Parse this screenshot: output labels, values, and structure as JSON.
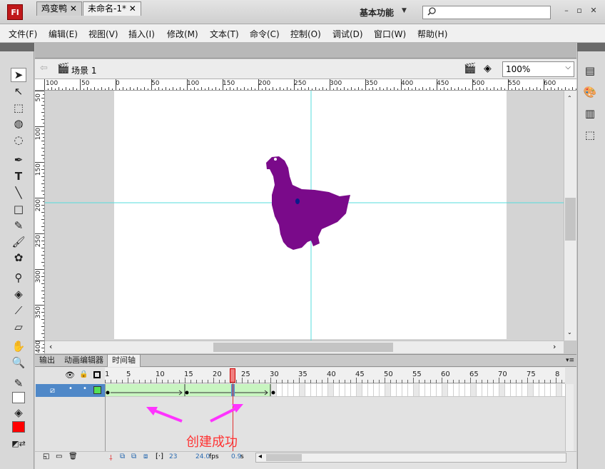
{
  "titlebar": {
    "logo": "Fl",
    "workspace": "基本功能",
    "search_placeholder": ""
  },
  "menu": [
    "文件(F)",
    "编辑(E)",
    "视图(V)",
    "插入(I)",
    "修改(M)",
    "文本(T)",
    "命令(C)",
    "控制(O)",
    "调试(D)",
    "窗口(W)",
    "帮助(H)"
  ],
  "doc_tabs": [
    {
      "label": "鸡变鸭",
      "active": false
    },
    {
      "label": "未命名-1*",
      "active": true
    }
  ],
  "scene": {
    "label": "场景 1",
    "zoom": "100%"
  },
  "ruler_top": [
    "100",
    "50",
    "0",
    "50",
    "100",
    "150",
    "200",
    "250",
    "300",
    "350",
    "400",
    "450",
    "500",
    "550",
    "600"
  ],
  "ruler_left": [
    "50",
    "100",
    "150",
    "200",
    "250",
    "300",
    "350",
    "400"
  ],
  "panel_tabs": [
    {
      "label": "输出",
      "active": false
    },
    {
      "label": "动画编辑器",
      "active": false
    },
    {
      "label": "时间轴",
      "active": true
    }
  ],
  "timeline": {
    "frame_numbers": [
      "1",
      "5",
      "10",
      "15",
      "20",
      "25",
      "30",
      "35",
      "40",
      "45",
      "50",
      "55",
      "60",
      "65",
      "70",
      "75",
      "8"
    ],
    "current_frame": "23",
    "fps": "24.0",
    "fps_unit": "fps",
    "elapsed": "0.9",
    "elapsed_unit": "s"
  },
  "annotation": "创建成功",
  "colors": {
    "stroke": "#000000",
    "fill": "#ff0000",
    "chicken": "#7a0a8a",
    "tween": "#c8f5c0",
    "layer_highlight": "#4f88c8"
  }
}
